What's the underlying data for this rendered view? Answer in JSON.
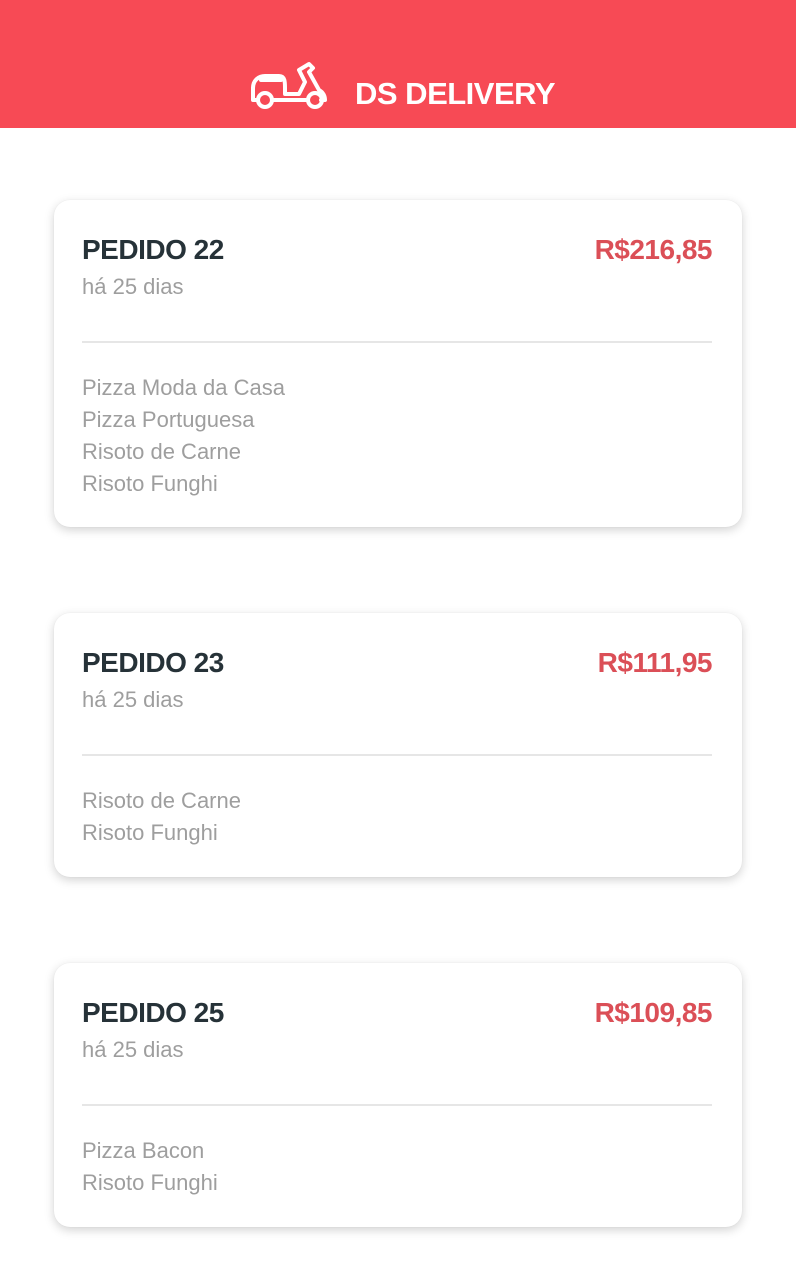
{
  "header": {
    "brand": "DS DELIVERY",
    "logo_icon": "scooter-icon",
    "background_color": "#f74a55"
  },
  "orders": [
    {
      "title": "PEDIDO 22",
      "date": "há 25 dias",
      "price": "R$216,85",
      "items": [
        "Pizza Moda da Casa",
        "Pizza Portuguesa",
        "Risoto de Carne",
        "Risoto Funghi"
      ]
    },
    {
      "title": "PEDIDO 23",
      "date": "há 25 dias",
      "price": "R$111,95",
      "items": [
        "Risoto de Carne",
        "Risoto Funghi"
      ]
    },
    {
      "title": "PEDIDO 25",
      "date": "há 25 dias",
      "price": "R$109,85",
      "items": [
        "Pizza Bacon",
        "Risoto Funghi"
      ]
    }
  ],
  "colors": {
    "price": "#db4f57",
    "title": "#263238",
    "muted": "#9e9e9e"
  }
}
